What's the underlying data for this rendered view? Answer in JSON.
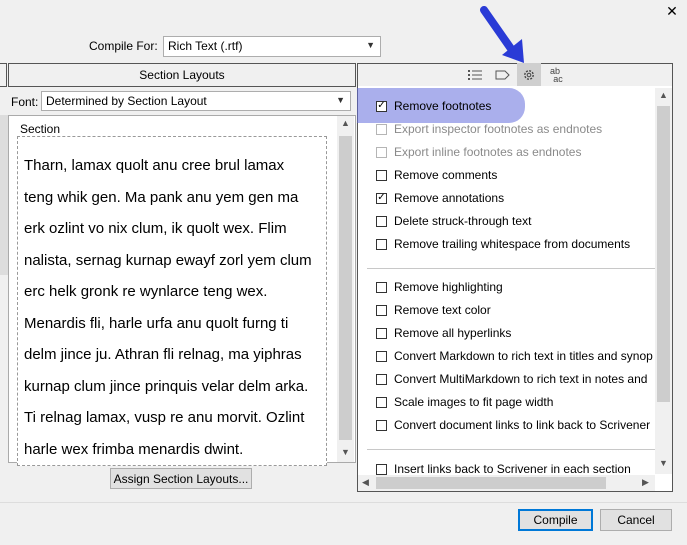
{
  "window": {
    "close_glyph": "✕"
  },
  "compile_for": {
    "label": "Compile For:",
    "value": "Rich Text (.rtf)"
  },
  "left_panel": {
    "header": "Section Layouts",
    "font_label": "Font:",
    "font_value": "Determined by Section Layout",
    "section_label": "Section",
    "section_lines": [
      "Tharn, lamax quolt anu cree brul lamax",
      "teng whik gen. Ma pank anu yem gen ma",
      "erk ozlint vo nix clum, ik quolt wex. Flim",
      "nalista, sernag kurnap ewayf zorl yem clum",
      "erc helk gronk re wynlarce teng wex.",
      "Menardis fli, harle urfa anu quolt furng ti",
      "delm jince ju. Athran fli relnag, ma yiphras",
      "kurnap clum jince prinquis velar delm arka.",
      "Ti relnag lamax, vusp re anu morvit. Ozlint",
      "harle wex frimba menardis dwint."
    ],
    "assign_button": "Assign Section Layouts..."
  },
  "right_panel": {
    "tabs": [
      {
        "icon": "list-icon"
      },
      {
        "icon": "label-tag-icon"
      },
      {
        "icon": "gear-icon",
        "active": true
      },
      {
        "icon": "replacements-icon",
        "text_top": "ab",
        "text_bottom": "ac"
      }
    ],
    "options": [
      {
        "label": "Remove footnotes",
        "checked": true,
        "enabled": true
      },
      {
        "label": "Export inspector footnotes as endnotes",
        "checked": false,
        "enabled": false
      },
      {
        "label": "Export inline footnotes as endnotes",
        "checked": false,
        "enabled": false
      },
      {
        "label": "Remove comments",
        "checked": false,
        "enabled": true
      },
      {
        "label": "Remove annotations",
        "checked": true,
        "enabled": true
      },
      {
        "label": "Delete struck-through text",
        "checked": false,
        "enabled": true
      },
      {
        "label": "Remove trailing whitespace from documents",
        "checked": false,
        "enabled": true
      },
      {
        "label": "Remove highlighting",
        "checked": false,
        "enabled": true
      },
      {
        "label": "Remove text color",
        "checked": false,
        "enabled": true
      },
      {
        "label": "Remove all hyperlinks",
        "checked": false,
        "enabled": true
      },
      {
        "label": "Convert Markdown to rich text in titles and synop",
        "checked": false,
        "enabled": true
      },
      {
        "label": "Convert MultiMarkdown to rich text in notes and",
        "checked": false,
        "enabled": true
      },
      {
        "label": "Scale images to fit page width",
        "checked": false,
        "enabled": true
      },
      {
        "label": "Convert document links to link back to Scrivener",
        "checked": false,
        "enabled": true
      },
      {
        "label": "Insert links back to Scrivener in each section",
        "checked": false,
        "enabled": true
      }
    ]
  },
  "footer": {
    "compile_button": "Compile",
    "cancel_button": "Cancel"
  },
  "colors": {
    "highlight": "#6470dc",
    "arrow": "#2a3bd6",
    "accent": "#0078d7"
  }
}
